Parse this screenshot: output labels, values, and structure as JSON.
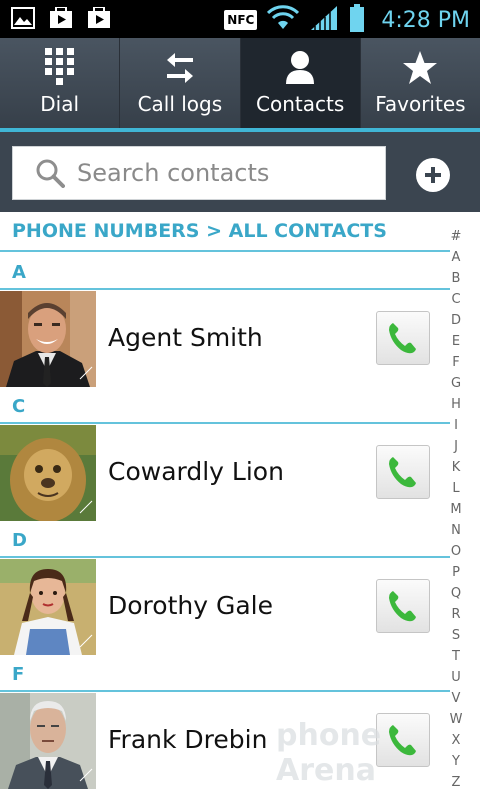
{
  "status_bar": {
    "nfc": "NFC",
    "time": "4:28 PM"
  },
  "tabs": [
    {
      "label": "Dial",
      "icon": "dialpad-icon",
      "active": false
    },
    {
      "label": "Call logs",
      "icon": "swap-arrows-icon",
      "active": false
    },
    {
      "label": "Contacts",
      "icon": "person-icon",
      "active": true
    },
    {
      "label": "Favorites",
      "icon": "star-icon",
      "active": false
    }
  ],
  "search": {
    "placeholder": "Search contacts"
  },
  "breadcrumb": "PHONE NUMBERS > ALL CONTACTS",
  "sections": [
    {
      "letter": "A",
      "contacts": [
        {
          "name": "Agent Smith"
        }
      ]
    },
    {
      "letter": "C",
      "contacts": [
        {
          "name": "Cowardly Lion"
        }
      ]
    },
    {
      "letter": "D",
      "contacts": [
        {
          "name": "Dorothy Gale"
        }
      ]
    },
    {
      "letter": "F",
      "contacts": [
        {
          "name": "Frank Drebin"
        }
      ]
    }
  ],
  "index_letters": [
    "#",
    "A",
    "B",
    "C",
    "D",
    "E",
    "F",
    "G",
    "H",
    "I",
    "J",
    "K",
    "L",
    "M",
    "N",
    "O",
    "P",
    "Q",
    "R",
    "S",
    "T",
    "U",
    "V",
    "W",
    "X",
    "Y",
    "Z"
  ],
  "watermark": "phone Arena",
  "colors": {
    "accent": "#40b6d6",
    "tab_bg": "#3b4550",
    "call_green": "#3cb83c"
  }
}
